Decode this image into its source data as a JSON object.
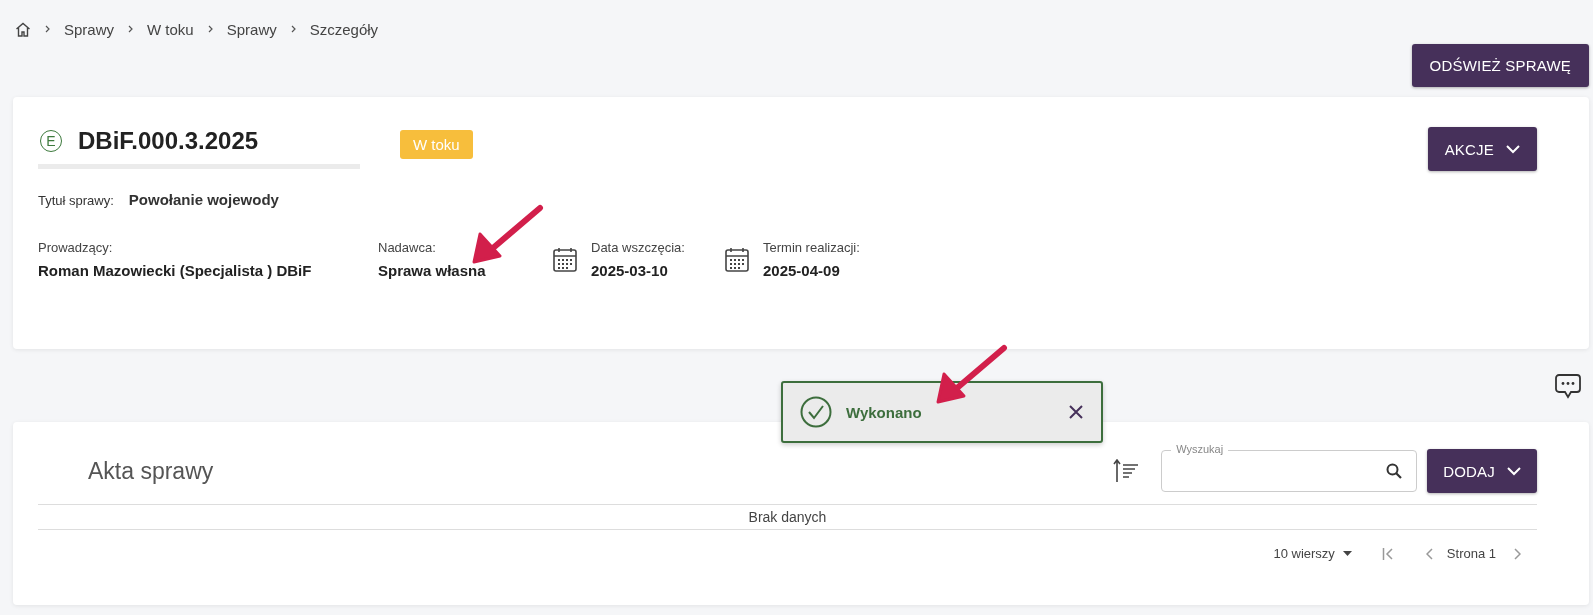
{
  "breadcrumb": [
    {
      "label": "Sprawy"
    },
    {
      "label": "W toku"
    },
    {
      "label": "Sprawy"
    },
    {
      "label": "Szczegóły"
    }
  ],
  "refresh_button": "ODŚWIEŻ SPRAWĘ",
  "case": {
    "type_letter": "E",
    "number": "DBiF.000.3.2025",
    "status": "W toku",
    "actions_button": "AKCJE",
    "title_label": "Tytuł sprawy:",
    "title_value": "Powołanie wojewody",
    "fields": [
      {
        "kind": "plain",
        "label": "Prowadzący:",
        "value": "Roman Mazowiecki (Specjalista ) DBiF"
      },
      {
        "kind": "plain",
        "label": "Nadawca:",
        "value": "Sprawa własna"
      },
      {
        "kind": "date",
        "label": "Data wszczęcia:",
        "value": "2025-03-10"
      },
      {
        "kind": "date",
        "label": "Termin realizacji:",
        "value": "2025-04-09"
      }
    ]
  },
  "toast": {
    "message": "Wykonano"
  },
  "files": {
    "title": "Akta sprawy",
    "search": {
      "placeholder": "Wyszukaj"
    },
    "add_button": "DODAJ",
    "empty": "Brak danych",
    "pagination": {
      "rows": "10 wierszy",
      "page": "Strona 1"
    }
  }
}
